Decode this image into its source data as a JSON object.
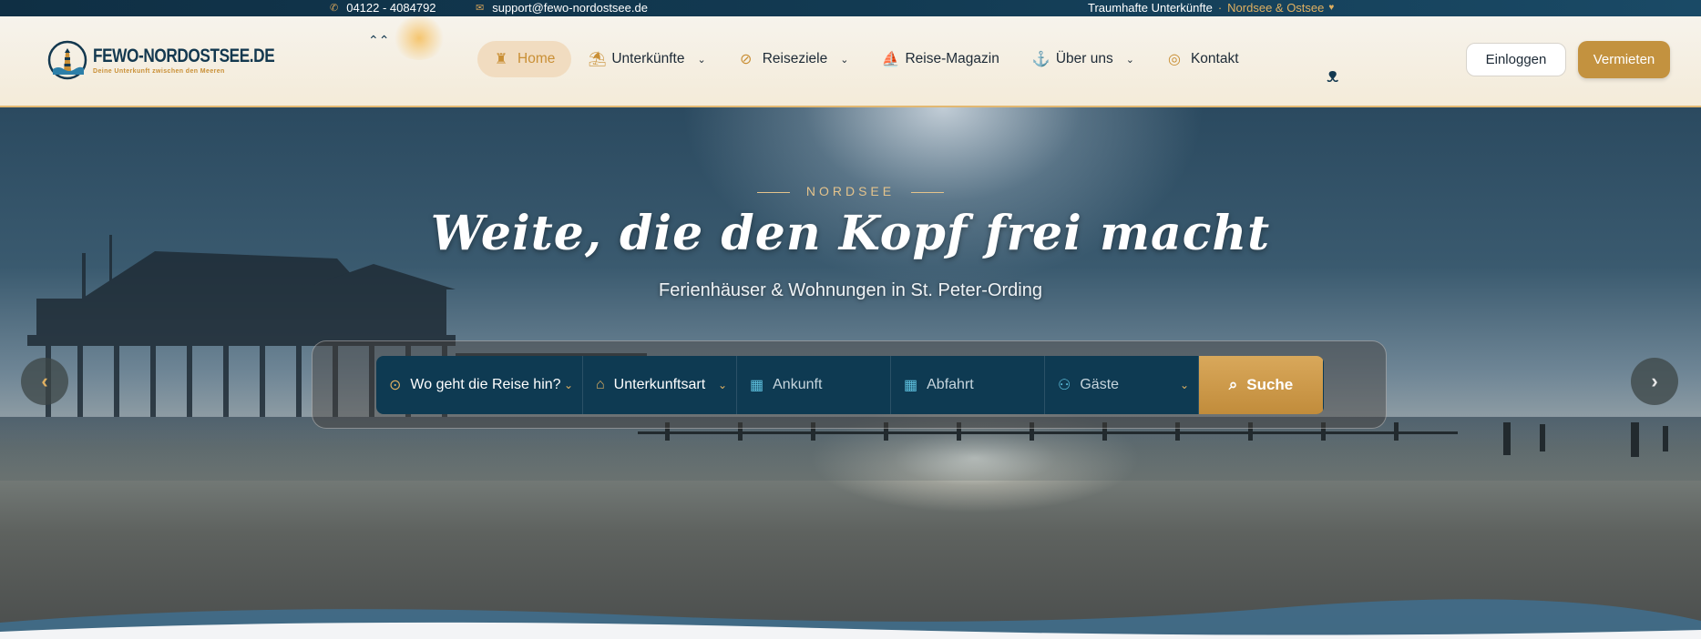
{
  "topbar": {
    "phone": "04122 - 4084792",
    "email": "support@fewo-nordostsee.de",
    "tagline": "Traumhafte Unterkünfte",
    "tagline_accent": "Nordsee & Ostsee",
    "heart": "♥",
    "phone_icon": "phone-icon",
    "mail_icon": "mail-icon"
  },
  "logo": {
    "title": "FEWO-NORDOSTSEE.DE",
    "subtitle": "Deine Unterkunft zwischen den Meeren"
  },
  "nav": {
    "items": [
      {
        "label": "Home",
        "icon": "lighthouse-icon"
      },
      {
        "label": "Unterkünfte",
        "icon": "beach-chair-icon"
      },
      {
        "label": "Reiseziele",
        "icon": "compass-icon"
      },
      {
        "label": "Reise-Magazin",
        "icon": "sailboat-icon"
      },
      {
        "label": "Über uns",
        "icon": "anchor-icon"
      },
      {
        "label": "Kontakt",
        "icon": "lifebuoy-icon"
      }
    ]
  },
  "header": {
    "login_label": "Einloggen",
    "rent_label": "Vermieten"
  },
  "hero": {
    "kicker": "NORDSEE",
    "title": "Weite, die den Kopf frei macht",
    "subtitle": "Ferienhäuser & Wohnungen in St. Peter-Ording"
  },
  "search": {
    "destination": "Wo geht die Reise hin?",
    "type": "Unterkunftsart",
    "arrival": "Ankunft",
    "departure": "Abfahrt",
    "guests": "Gäste",
    "submit": "Suche"
  },
  "colors": {
    "accent": "#c3923f",
    "navy": "#0e3a52"
  }
}
